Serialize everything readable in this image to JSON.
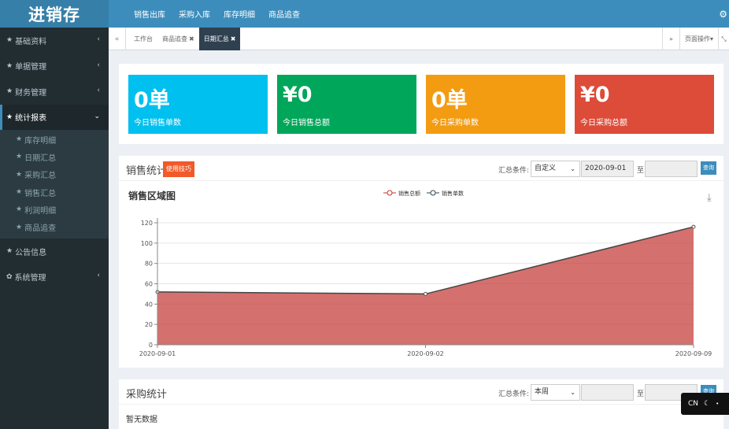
{
  "app": {
    "logo": "进销存"
  },
  "topnav": {
    "items": [
      "销售出库",
      "采购入库",
      "库存明细",
      "商品追查"
    ],
    "gear_icon": "gear-icon"
  },
  "sidebar": {
    "items": [
      {
        "label": "基础资料",
        "icon": "star-icon",
        "has_children": true
      },
      {
        "label": "单据管理",
        "icon": "star-icon",
        "has_children": true
      },
      {
        "label": "财务管理",
        "icon": "star-icon",
        "has_children": true
      },
      {
        "label": "统计报表",
        "icon": "star-icon",
        "has_children": true,
        "expanded": true
      }
    ],
    "subitems": [
      "库存明细",
      "日期汇总",
      "采购汇总",
      "销售汇总",
      "利润明细",
      "商品追查"
    ],
    "bottom_items": [
      {
        "label": "公告信息",
        "icon": "star-icon",
        "has_children": false
      },
      {
        "label": "系统管理",
        "icon": "gear-icon",
        "has_children": true
      }
    ]
  },
  "tabbar": {
    "tabs": [
      {
        "label": "工作台",
        "closable": false,
        "active": false
      },
      {
        "label": "商品追查",
        "closable": true,
        "active": false
      },
      {
        "label": "日期汇总",
        "closable": true,
        "active": true
      }
    ],
    "page_ops": "页面操作"
  },
  "stats": [
    {
      "value": "0单",
      "label": "今日销售单数",
      "color": "#00c0ef"
    },
    {
      "value": "¥0",
      "label": "今日销售总额",
      "color": "#00a65a"
    },
    {
      "value": "0单",
      "label": "今日采购单数",
      "color": "#f39c12"
    },
    {
      "value": "¥0",
      "label": "今日采购总额",
      "color": "#dd4b39"
    }
  ],
  "sales": {
    "title": "销售统计",
    "tip_button": "使用技巧",
    "cond_label": "汇总条件:",
    "cond_value": "自定义",
    "date_from": "2020-09-01",
    "date_to": "",
    "to_label": "至",
    "query": "查询"
  },
  "chart_data": {
    "type": "area",
    "title": "销售区域图",
    "x": [
      "2020-09-01",
      "2020-09-02",
      "2020-09-09"
    ],
    "series": [
      {
        "name": "销售总额",
        "values": [
          52,
          50,
          116
        ],
        "color": "#c23531"
      },
      {
        "name": "销售单数",
        "values": [
          null,
          null,
          null
        ],
        "color": "#2f4554"
      }
    ],
    "y_ticks": [
      0,
      20,
      40,
      60,
      80,
      100,
      120
    ],
    "ylim": [
      0,
      120
    ],
    "grid": true,
    "legend_position": "top-center",
    "download_icon": "download-icon"
  },
  "purchase": {
    "title": "采购统计",
    "cond_label": "汇总条件:",
    "cond_value": "本周",
    "date_from": "",
    "date_to": "",
    "to_label": "至",
    "query": "查询",
    "empty_text": "暂无数据"
  },
  "lang_toggle": {
    "label": "CN",
    "moon_icon": "moon-icon"
  }
}
